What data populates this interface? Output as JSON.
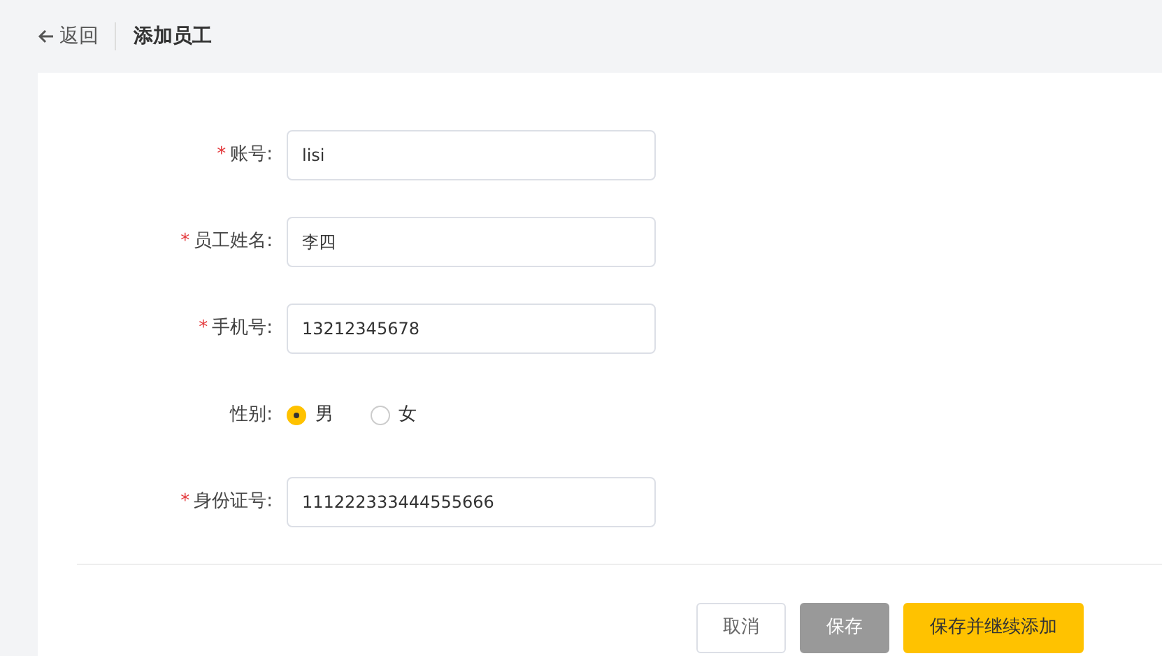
{
  "header": {
    "back": "返回",
    "title": "添加员工"
  },
  "fields": [
    {
      "kind": "text",
      "required_mark": "*",
      "label": "账号:",
      "value": "lisi"
    },
    {
      "kind": "text",
      "required_mark": "*",
      "label": "员工姓名:",
      "value": "李四"
    },
    {
      "kind": "text",
      "required_mark": "*",
      "label": "手机号:",
      "value": "13212345678"
    },
    {
      "kind": "radio",
      "label": "性别:",
      "options": [
        {
          "label": "男",
          "selected": true
        },
        {
          "label": "女",
          "selected": false
        }
      ]
    },
    {
      "kind": "text",
      "required_mark": "*",
      "label": "身份证号:",
      "value": "111222333444555666"
    }
  ],
  "buttons": [
    {
      "kind": "outline",
      "label": "取消"
    },
    {
      "kind": "muted",
      "label": "保存"
    },
    {
      "kind": "primary",
      "label": "保存并继续添加"
    }
  ]
}
